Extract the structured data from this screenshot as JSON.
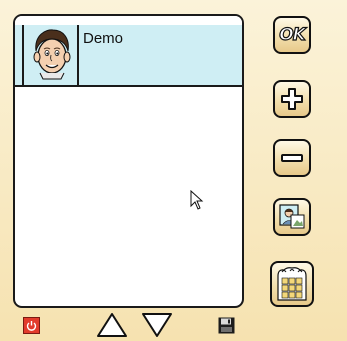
{
  "users": [
    {
      "name": "Demo",
      "avatar_icon": "cartoon-face-avatar"
    }
  ],
  "buttons": {
    "ok_label": "OK",
    "add_icon": "plus-icon",
    "remove_icon": "minus-icon",
    "photo_icon": "photo-icon",
    "keypad_icon": "keypad-icon"
  },
  "bottom_bar": {
    "power_icon": "power-icon",
    "up_icon": "up-arrow-icon",
    "down_icon": "down-arrow-icon",
    "save_icon": "floppy-disk-icon"
  },
  "colors": {
    "background": "#f6e2b0",
    "selected_row": "#cfeef4",
    "power": "#e23b2c"
  }
}
